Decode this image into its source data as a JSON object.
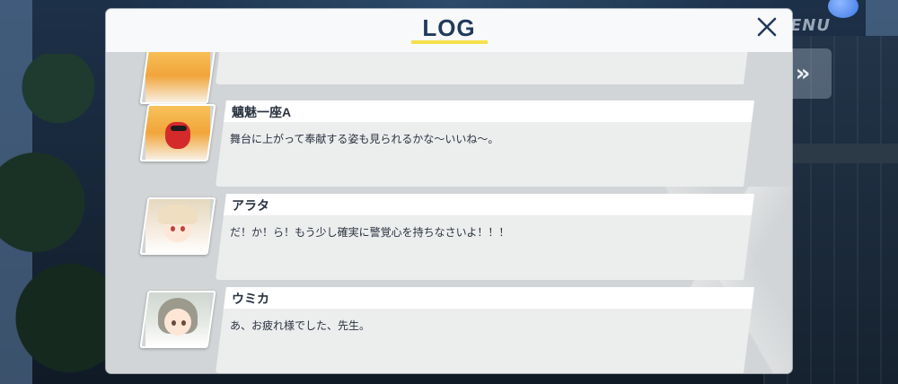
{
  "background": {
    "menu_label": "ENU",
    "skip_label": "»"
  },
  "log_panel": {
    "title": "LOG",
    "close_glyph": "✕",
    "entries": [
      {
        "speaker": "魑魅一座A",
        "text": "舞台に上がって奉献する姿も見られるかな～いいね～。",
        "avatar_icon": "masked-character-portrait"
      },
      {
        "speaker": "アラタ",
        "text": "だ！か！ら！もう少し確実に警覚心を持ちなさいよ！！！",
        "avatar_icon": "blonde-catgirl-portrait"
      },
      {
        "speaker": "ウミカ",
        "text": "あ、お疲れ様でした、先生。",
        "avatar_icon": "gray-haired-girl-portrait"
      }
    ]
  },
  "colors": {
    "title": "#213a5c",
    "underline": "#f5e04a",
    "panel_bg": "#d2d5d7",
    "bubble": "#eceded"
  }
}
